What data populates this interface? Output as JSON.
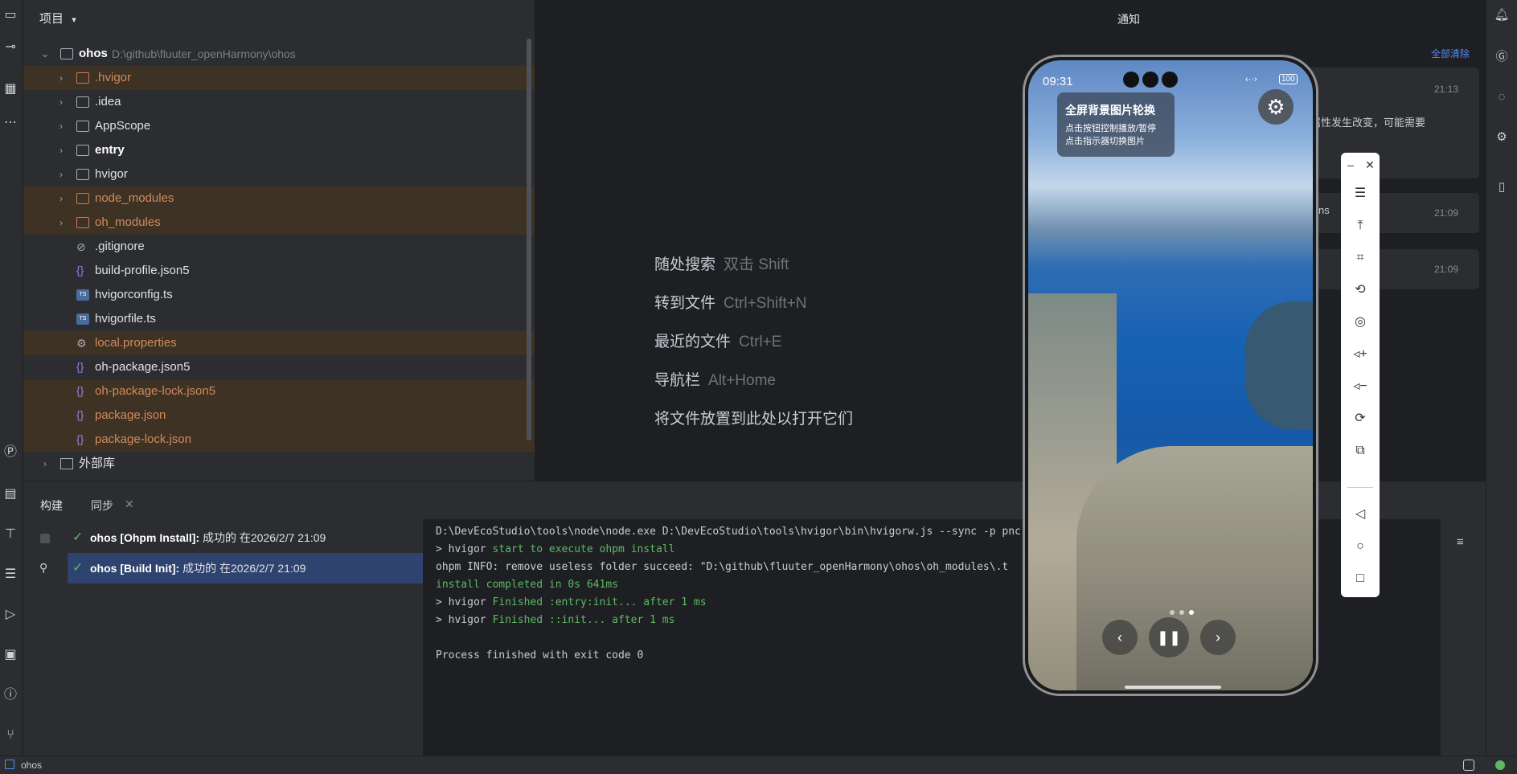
{
  "project": {
    "header": "项目",
    "root": {
      "name": "ohos",
      "path": "D:\\github\\fluuter_openHarmony\\ohos"
    },
    "items": [
      {
        "label": ".hvigor",
        "type": "folder",
        "excluded": true
      },
      {
        "label": ".idea",
        "type": "folder",
        "excluded": false
      },
      {
        "label": "AppScope",
        "type": "folder",
        "excluded": false
      },
      {
        "label": "entry",
        "type": "module",
        "excluded": false
      },
      {
        "label": "hvigor",
        "type": "folder",
        "excluded": false
      },
      {
        "label": "node_modules",
        "type": "folder",
        "excluded": true
      },
      {
        "label": "oh_modules",
        "type": "folder",
        "excluded": true
      },
      {
        "label": ".gitignore",
        "type": "ignore",
        "excluded": false
      },
      {
        "label": "build-profile.json5",
        "type": "json",
        "excluded": false
      },
      {
        "label": "hvigorconfig.ts",
        "type": "ts",
        "excluded": false
      },
      {
        "label": "hvigorfile.ts",
        "type": "ts",
        "excluded": false
      },
      {
        "label": "local.properties",
        "type": "props",
        "excluded": true
      },
      {
        "label": "oh-package.json5",
        "type": "json",
        "excluded": false
      },
      {
        "label": "oh-package-lock.json5",
        "type": "json",
        "excluded": true
      },
      {
        "label": "package.json",
        "type": "json",
        "excluded": true
      },
      {
        "label": "package-lock.json",
        "type": "json",
        "excluded": true
      }
    ],
    "external": "外部库"
  },
  "editor_hints": [
    {
      "action": "随处搜索",
      "key": "双击 Shift"
    },
    {
      "action": "转到文件",
      "key": "Ctrl+Shift+N"
    },
    {
      "action": "最近的文件",
      "key": "Ctrl+E"
    },
    {
      "action": "导航栏",
      "key": "Alt+Home"
    },
    {
      "action": "将文件放置到此处以打开它们",
      "key": ""
    }
  ],
  "notifications": {
    "title": "通知",
    "clear_all": "全部清除",
    "cards": [
      {
        "time": "21:13",
        "text": "配置属性发生改变，可能需要"
      },
      {
        "time": "21:09",
        "text": "ns"
      },
      {
        "time": "21:09",
        "text": ""
      }
    ]
  },
  "bottom": {
    "tabs": [
      "构建",
      "同步"
    ],
    "builds": [
      {
        "name": "ohos [Ohpm Install]:",
        "status": "成功的 在2026/2/7 21:09",
        "selected": false
      },
      {
        "name": "ohos [Build Init]:",
        "status": "成功的 在2026/2/7 21:09",
        "selected": true
      }
    ],
    "console": [
      {
        "prefix": "D:\\DevEcoStudio\\tools\\node\\node.exe D:\\DevEcoStudio\\tools\\hvigor\\bin\\hvigorw.js --sync -p p",
        "green": "",
        "suffix": "ncre  --daemon"
      },
      {
        "prefix": "> hvigor ",
        "green": "start to execute ohpm install",
        "suffix": ""
      },
      {
        "prefix": "ohpm INFO: remove useless folder succeed: \"D:\\github\\fluuter_openHarmony\\ohos\\oh_modules\\.t",
        "green": "",
        "suffix": ""
      },
      {
        "prefix": "",
        "green": "install completed in 0s 641ms",
        "suffix": ""
      },
      {
        "prefix": "> hvigor ",
        "green": "Finished :entry:init... after 1 ms",
        "suffix": ""
      },
      {
        "prefix": "> hvigor ",
        "green": "Finished ::init... after 1 ms",
        "suffix": ""
      },
      {
        "prefix": "",
        "green": "",
        "suffix": ""
      },
      {
        "prefix": "Process finished with exit code 0",
        "green": "",
        "suffix": ""
      }
    ]
  },
  "status_bar": {
    "project": "ohos"
  },
  "phone": {
    "time": "09:31",
    "battery": "100",
    "card_title": "全屏背景图片轮换",
    "card_line1": "点击按钮控制播放/暂停",
    "card_line2": "点击指示器切换图片"
  }
}
